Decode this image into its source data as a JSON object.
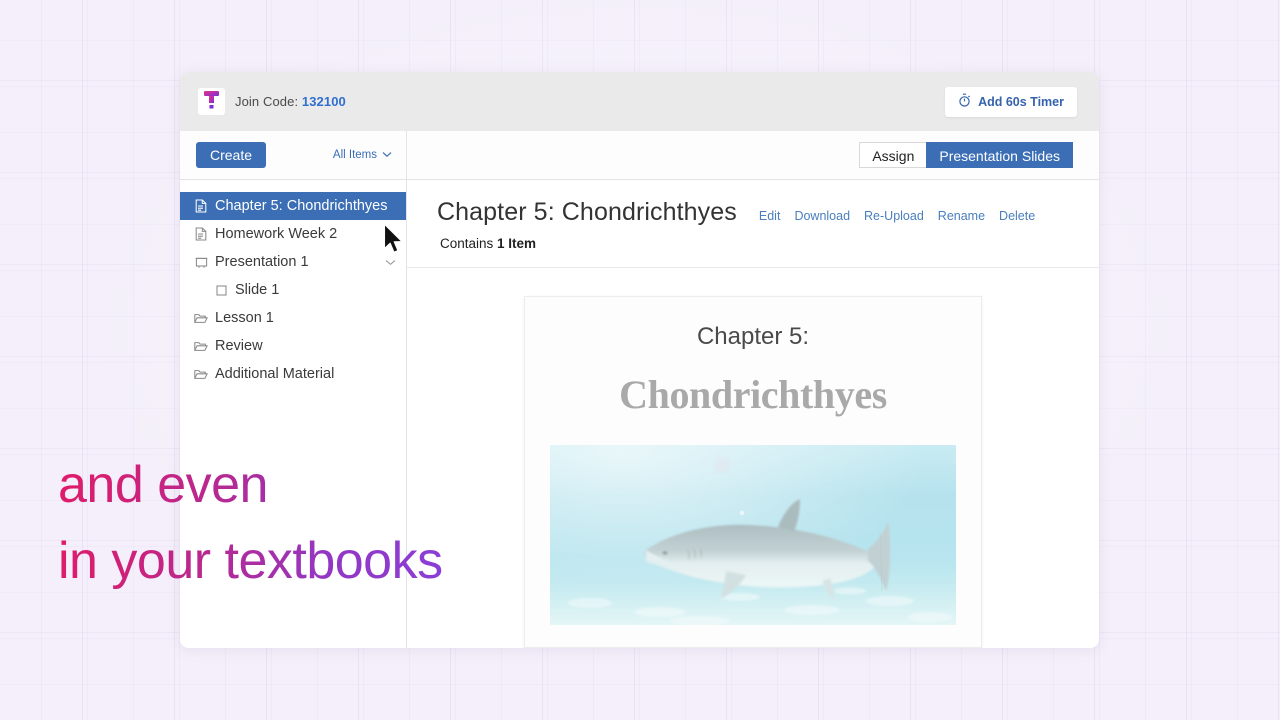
{
  "topbar": {
    "logo_icon": "nearpod-t-logo-icon",
    "join_code_label": "Join Code:",
    "join_code_value": "132100",
    "timer_button_label": "Add 60s Timer",
    "timer_icon": "stopwatch-icon",
    "background_color": "#eaeaea"
  },
  "toolbar": {
    "create_label": "Create",
    "filter_label": "All Items",
    "filter_caret_icon": "chevron-down-icon",
    "tabs": [
      {
        "label": "Assign",
        "active": false
      },
      {
        "label": "Presentation Slides",
        "active": true
      }
    ],
    "accent_color": "#3b6eb5"
  },
  "sidebar": {
    "items": [
      {
        "label": "Chapter 5: Chondrichthyes",
        "icon": "document-icon",
        "selected": true,
        "child": false,
        "caret": false
      },
      {
        "label": "Homework Week 2",
        "icon": "document-icon",
        "selected": false,
        "child": false,
        "caret": false
      },
      {
        "label": "Presentation 1",
        "icon": "presentation-icon",
        "selected": false,
        "child": false,
        "caret": true
      },
      {
        "label": "Slide 1",
        "icon": "slide-square-icon",
        "selected": false,
        "child": true,
        "caret": false
      },
      {
        "label": "Lesson 1",
        "icon": "folder-icon",
        "selected": false,
        "child": false,
        "caret": false
      },
      {
        "label": "Review",
        "icon": "folder-icon",
        "selected": false,
        "child": false,
        "caret": false
      },
      {
        "label": "Additional Material",
        "icon": "folder-icon",
        "selected": false,
        "child": false,
        "caret": false
      }
    ]
  },
  "main": {
    "title": "Chapter 5: Chondrichthyes",
    "actions": [
      "Edit",
      "Download",
      "Re-Upload",
      "Rename",
      "Delete"
    ],
    "contains_prefix": "Contains ",
    "contains_count": "1 Item",
    "slide": {
      "line1": "Chapter 5:",
      "line2": "Chondrichthyes",
      "photo_alt": "shark-underwater-photo"
    }
  },
  "caption": {
    "text": "and even\nin your textbooks",
    "gradient_start": "#e01b6a",
    "gradient_end": "#8b3fd6"
  },
  "cursor": {
    "icon": "arrow-pointer-icon"
  }
}
